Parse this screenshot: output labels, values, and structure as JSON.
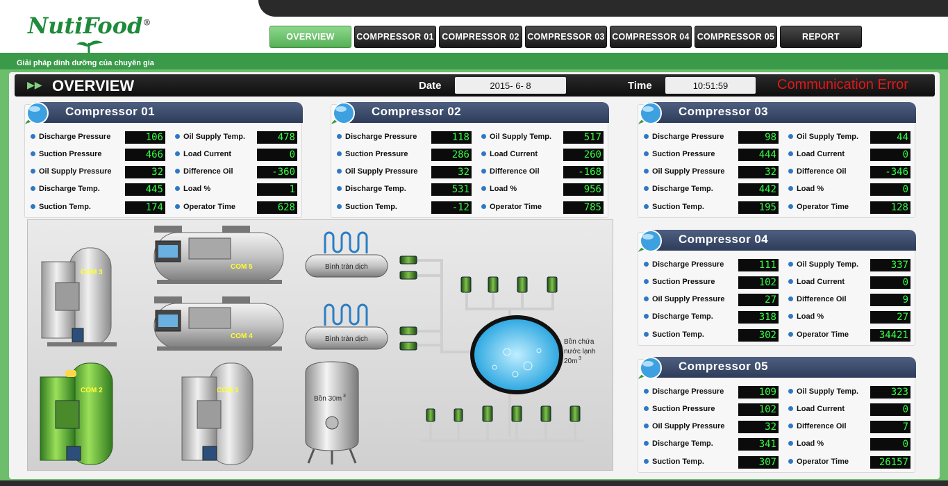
{
  "brand": {
    "logo_text": "NutiFood",
    "registered_mark": "®",
    "tagline": "Giải pháp dinh dưỡng của chuyên gia"
  },
  "nav": {
    "items": [
      {
        "label": "OVERVIEW",
        "active": true
      },
      {
        "label": "COMPRESSOR 01",
        "active": false
      },
      {
        "label": "COMPRESSOR 02",
        "active": false
      },
      {
        "label": "COMPRESSOR 03",
        "active": false
      },
      {
        "label": "COMPRESSOR 04",
        "active": false
      },
      {
        "label": "COMPRESSOR 05",
        "active": false
      },
      {
        "label": "REPORT",
        "active": false
      }
    ]
  },
  "topbar": {
    "title": "OVERVIEW",
    "date_label": "Date",
    "date_value": "2015- 6- 8",
    "time_label": "Time",
    "time_value": "10:51:59",
    "status": "Communication Error"
  },
  "labels": {
    "discharge_pressure": "Discharge Pressure",
    "suction_pressure": "Suction Pressure",
    "oil_supply_pressure": "Oil Supply Pressure",
    "discharge_temp": "Discharge Temp.",
    "suction_temp": "Suction Temp.",
    "oil_supply_temp": "Oil Supply Temp.",
    "load_current": "Load Current",
    "difference_oil": "Difference Oil",
    "load_pct": "Load %",
    "operator_time": "Operator Time"
  },
  "compressors": [
    {
      "title": "Compressor 01",
      "discharge_pressure": "106",
      "suction_pressure": "466",
      "oil_supply_pressure": "32",
      "discharge_temp": "445",
      "suction_temp": "174",
      "oil_supply_temp": "478",
      "load_current": "0",
      "difference_oil": "-360",
      "load_pct": "1",
      "operator_time": "628"
    },
    {
      "title": "Compressor 02",
      "discharge_pressure": "118",
      "suction_pressure": "286",
      "oil_supply_pressure": "32",
      "discharge_temp": "531",
      "suction_temp": "-12",
      "oil_supply_temp": "517",
      "load_current": "260",
      "difference_oil": "-168",
      "load_pct": "956",
      "operator_time": "785"
    },
    {
      "title": "Compressor 03",
      "discharge_pressure": "98",
      "suction_pressure": "444",
      "oil_supply_pressure": "32",
      "discharge_temp": "442",
      "suction_temp": "195",
      "oil_supply_temp": "44",
      "load_current": "0",
      "difference_oil": "-346",
      "load_pct": "0",
      "operator_time": "128"
    },
    {
      "title": "Compressor 04",
      "discharge_pressure": "111",
      "suction_pressure": "102",
      "oil_supply_pressure": "27",
      "discharge_temp": "318",
      "suction_temp": "302",
      "oil_supply_temp": "337",
      "load_current": "0",
      "difference_oil": "9",
      "load_pct": "27",
      "operator_time": "34421"
    },
    {
      "title": "Compressor 05",
      "discharge_pressure": "109",
      "suction_pressure": "102",
      "oil_supply_pressure": "32",
      "discharge_temp": "341",
      "suction_temp": "307",
      "oil_supply_temp": "323",
      "load_current": "0",
      "difference_oil": "7",
      "load_pct": "0",
      "operator_time": "26157"
    }
  ],
  "diagram": {
    "com3": "COM 3",
    "com5": "COM 5",
    "com4": "COM 4",
    "com2": "COM 2",
    "com1": "COM 1",
    "receiver_1": "Bình tràn dịch",
    "receiver_2": "Bình tràn dịch",
    "tank_30": "Bồn 30m",
    "tank_30_sup": "3",
    "chilled_tank_line1": "Bồn chứa",
    "chilled_tank_line2": "nước lạnh",
    "chilled_tank_line3": "20m",
    "chilled_tank_sup": "3"
  },
  "colors": {
    "brand_green": "#1f8a3a",
    "frame_green": "#6cbd6c",
    "readout_green": "#33ff44",
    "error_red": "#e01818",
    "card_header": "#3d4d6d",
    "compressor_running": "#4caf3a",
    "compressor_idle": "#b8b8b8",
    "water": "#3fb6e8"
  },
  "icons": [
    "globe-icon",
    "sprout-icon",
    "double-arrow-icon",
    "bullet-dot-icon",
    "pump-icon"
  ]
}
